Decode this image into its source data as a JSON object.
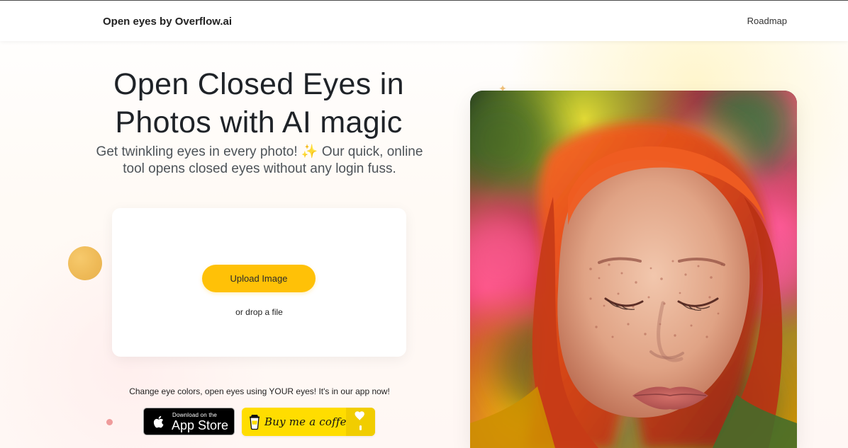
{
  "header": {
    "brand": "Open eyes by Overflow.ai",
    "nav_roadmap": "Roadmap"
  },
  "hero": {
    "title_line_1": "Open Closed Eyes in",
    "title_line_2": "Photos with AI magic",
    "subtitle_line_1": "Get twinkling eyes in every photo! ✨ Our quick, online",
    "subtitle_line_2": "tool opens closed eyes without any login fuss."
  },
  "upload": {
    "button_label": "Upload Image",
    "drop_text": "or drop a file"
  },
  "promo": {
    "text": "Change eye colors, open eyes using YOUR eyes! It's in our app now!"
  },
  "app_store": {
    "small_text": "Download on the",
    "big_text": "App Store",
    "icon": "apple-icon"
  },
  "coffee": {
    "label": "Buy me a coffee",
    "cup_icon": "coffee-cup-icon",
    "heart_icon": "heart-icon"
  },
  "icons": {
    "decor_star": "sparkle-icon"
  },
  "colors": {
    "accent": "#ffc107",
    "coffee": "#ffdd00",
    "deco_circle": "#edb64e",
    "deco_dot": "#ef9b9b"
  }
}
